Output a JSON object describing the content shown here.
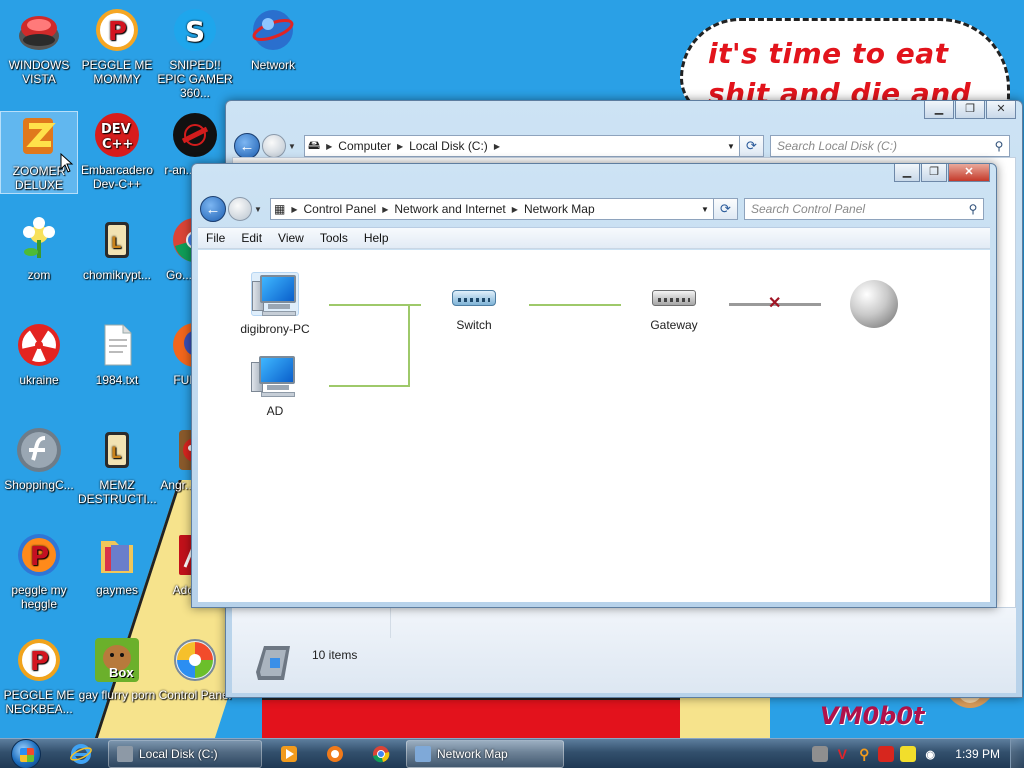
{
  "wallpaper": {
    "caption": "it's time to eat shit and die and chew",
    "logo": "VM0b0t"
  },
  "desktop_icons": [
    {
      "label": "WINDOWS VISTA",
      "icon": "vista-icon"
    },
    {
      "label": "PEGGLE ME MOMMY",
      "icon": "peggle-icon"
    },
    {
      "label": "SNIPED!! EPIC GAMER 360...",
      "icon": "skype-icon"
    },
    {
      "label": "Network",
      "icon": "network-icon"
    },
    {
      "label": "ZOOMER DELUXE",
      "icon": "zoomer-icon"
    },
    {
      "label": "Embarcadero Dev-C++",
      "icon": "devcpp-icon"
    },
    {
      "label": "r-an... par...",
      "icon": "r-app-icon"
    },
    {
      "label": "zom",
      "icon": "plant-icon"
    },
    {
      "label": "chomikrypt...",
      "icon": "lock-app-icon"
    },
    {
      "label": "Go... Chr...",
      "icon": "chrome-icon"
    },
    {
      "label": "ukraine",
      "icon": "radiation-icon"
    },
    {
      "label": "1984.txt",
      "icon": "text-file-icon"
    },
    {
      "label": "FURR...",
      "icon": "firefox-icon"
    },
    {
      "label": "ShoppingC...",
      "icon": "flash-icon"
    },
    {
      "label": "MEMZ DESTRUCTI...",
      "icon": "lock-app-icon"
    },
    {
      "label": "Angr... Sea...",
      "icon": "angry-birds-icon"
    },
    {
      "label": "peggle my heggle",
      "icon": "peggle-icon"
    },
    {
      "label": "gaymes",
      "icon": "folder-icon"
    },
    {
      "label": "Adobe...",
      "icon": "adobe-icon"
    },
    {
      "label": "PEGGLE ME NECKBEA...",
      "icon": "peggle-icon"
    },
    {
      "label": "gay flurry porn",
      "icon": "box-app-icon"
    },
    {
      "label": "Control Panel",
      "icon": "control-panel-icon"
    }
  ],
  "box_app_text": "Box",
  "explorer_back": {
    "breadcrumbs": [
      "Computer",
      "Local Disk (C:)"
    ],
    "search_placeholder": "Search Local Disk (C:)",
    "status_count": "10 items"
  },
  "network_window": {
    "breadcrumbs": [
      "Control Panel",
      "Network and Internet",
      "Network Map"
    ],
    "search_placeholder": "Search Control Panel",
    "menu": [
      "File",
      "Edit",
      "View",
      "Tools",
      "Help"
    ],
    "nodes": {
      "pc1": "digibrony-PC",
      "pc2": "AD",
      "switch": "Switch",
      "gateway": "Gateway"
    }
  },
  "taskbar": {
    "tasks": [
      {
        "label": "Local Disk (C:)"
      },
      {
        "label": "Network Map"
      }
    ],
    "clock": "1:39 PM"
  },
  "colors": {
    "desktop_bg": "#2aa0e6",
    "link_ok": "#9ec96a",
    "link_broken": "#a01424",
    "caption_red": "#e2141c"
  }
}
